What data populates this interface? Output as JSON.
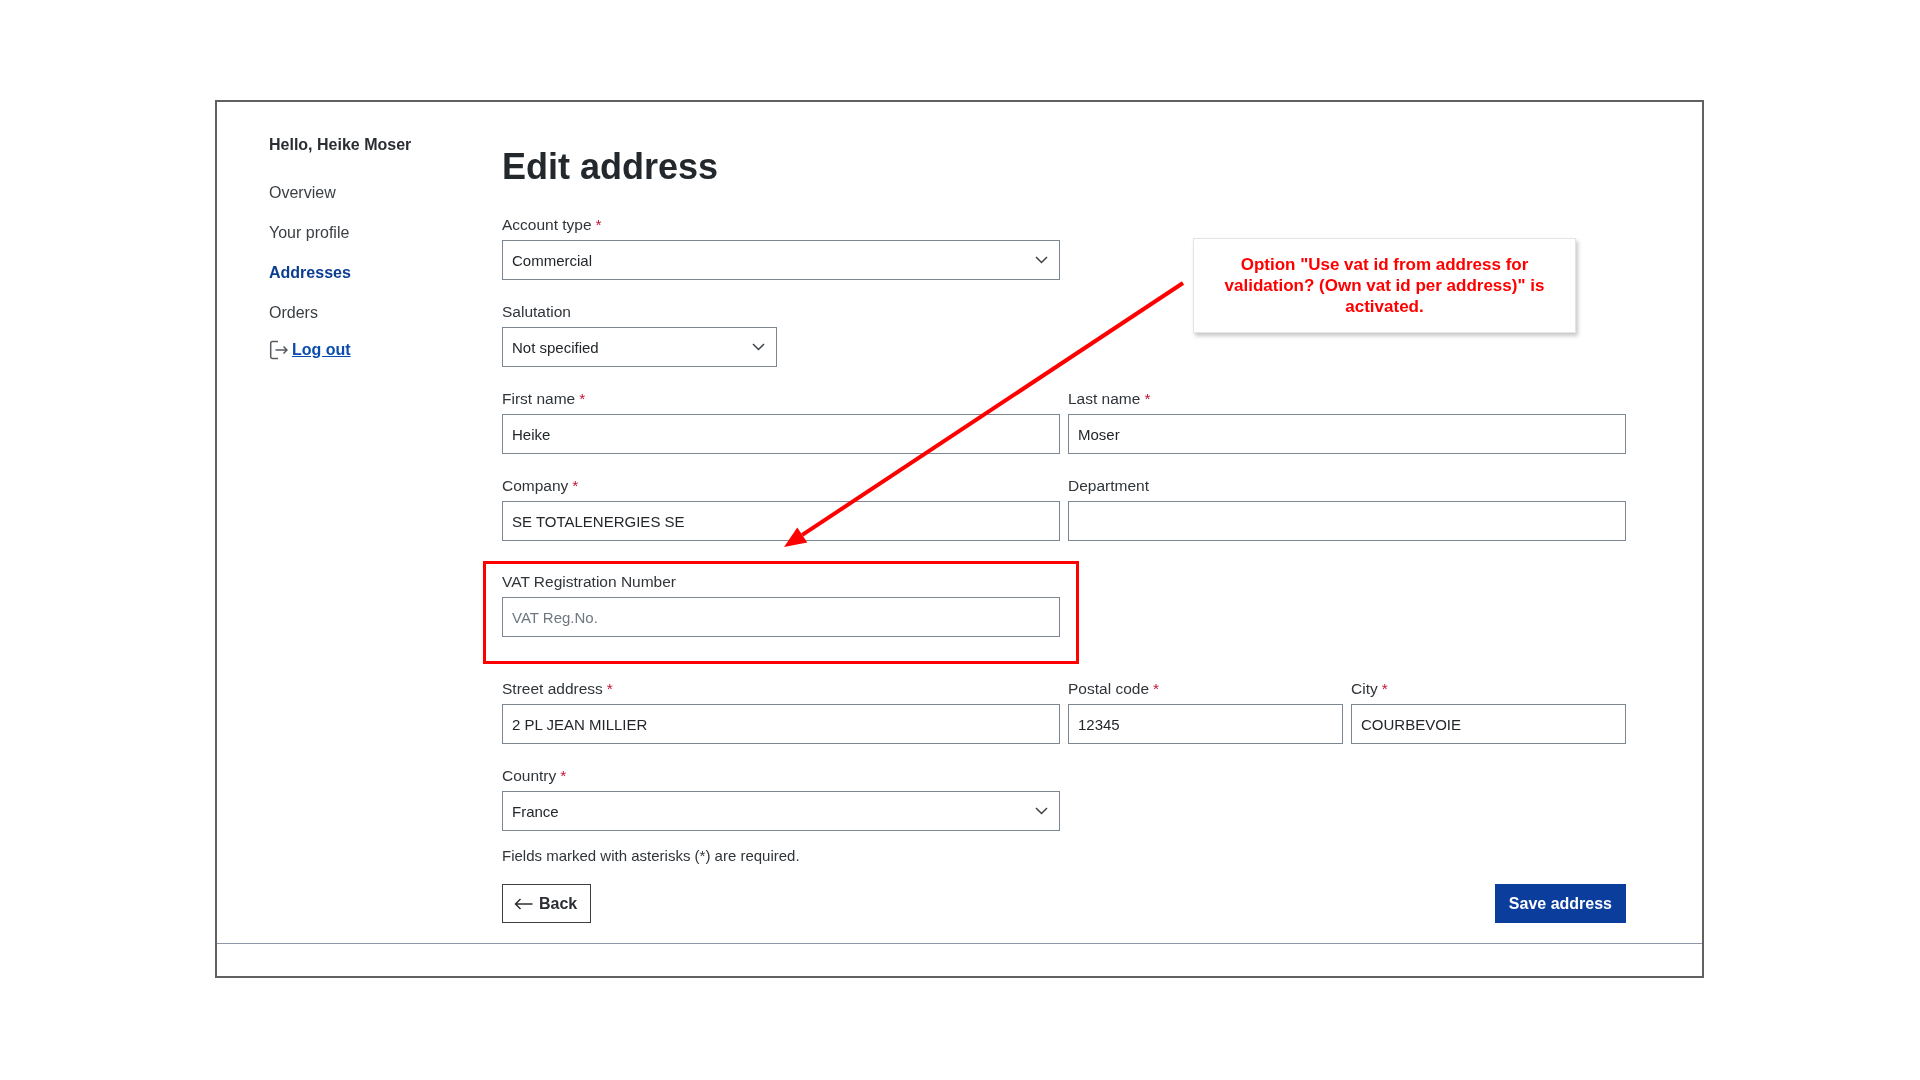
{
  "sidebar": {
    "greeting": "Hello, Heike Moser",
    "items": [
      {
        "label": "Overview",
        "selected": false
      },
      {
        "label": "Your profile",
        "selected": false
      },
      {
        "label": "Addresses",
        "selected": true
      },
      {
        "label": "Orders",
        "selected": false
      }
    ],
    "logout": "Log out"
  },
  "form": {
    "title": "Edit address",
    "rows": [
      [
        {
          "kind": "select",
          "label": "Account type",
          "asterisk": "*",
          "value": "Commercial",
          "highlighted": false
        }
      ],
      [
        {
          "kind": "select",
          "label": "Salutation",
          "value": "Not specified",
          "highlighted": false
        }
      ],
      [
        {
          "kind": "input",
          "label": "First name",
          "asterisk": "*",
          "value": "Heike",
          "highlighted": false
        },
        {
          "kind": "input",
          "label": "Last name",
          "asterisk": "*",
          "value": "Moser",
          "highlighted": false
        }
      ],
      [
        {
          "kind": "input",
          "label": "Company",
          "asterisk": "*",
          "value": "SE TOTALENERGIES SE",
          "highlighted": false
        },
        {
          "kind": "input",
          "label": "Department",
          "highlighted": false
        }
      ],
      [
        {
          "kind": "input",
          "label": "VAT Registration Number",
          "placeholder": "VAT Reg.No.",
          "highlighted": true
        }
      ],
      [
        {
          "kind": "input",
          "label": "Street address",
          "asterisk": "*",
          "value": "2 PL JEAN MILLIER",
          "highlighted": false
        },
        {
          "kind": "input",
          "label": "Postal code",
          "asterisk": "*",
          "value": "12345",
          "highlighted": false
        },
        {
          "kind": "input",
          "label": "City",
          "asterisk": "*",
          "value": "COURBEVOIE",
          "highlighted": false
        }
      ],
      [
        {
          "kind": "select",
          "label": "Country",
          "asterisk": "*",
          "value": "France",
          "highlighted": false
        }
      ]
    ],
    "note": "Fields marked with asterisks (*) are required.",
    "back_button": "Back",
    "save_button": "Save address"
  },
  "callout": {
    "text": "Option \"Use vat id from address for validation? (Own vat id per address)\" is activated."
  }
}
